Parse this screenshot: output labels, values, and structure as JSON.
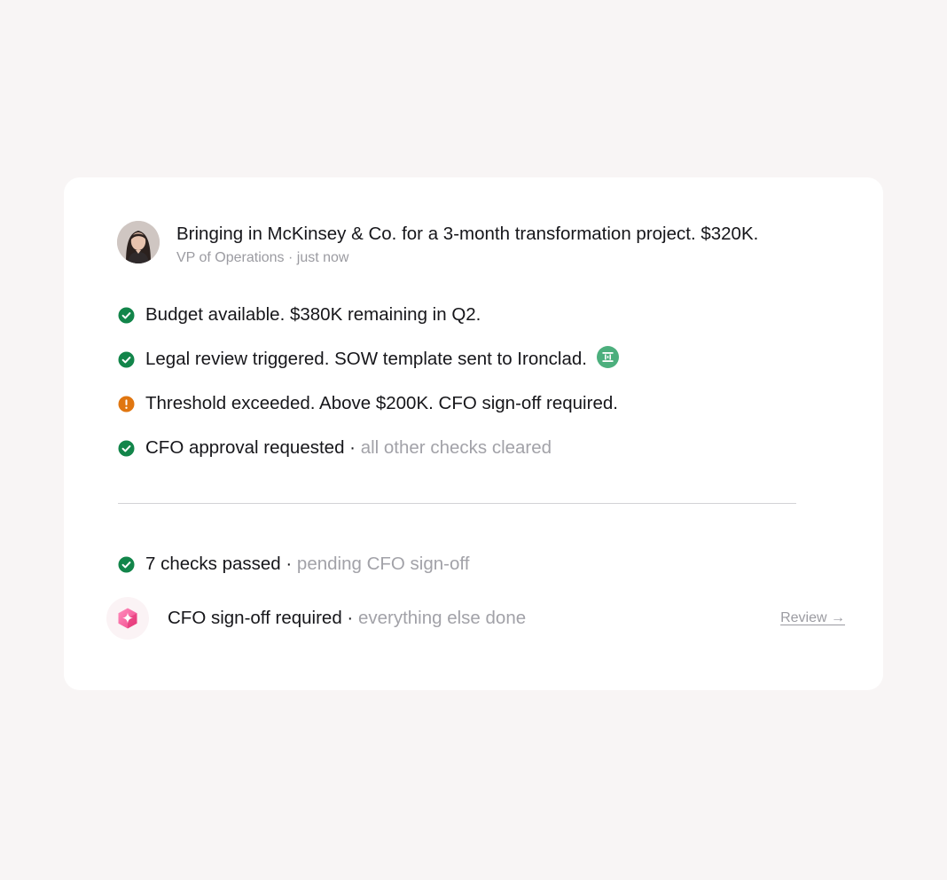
{
  "request": {
    "title": "Bringing in McKinsey & Co. for a 3-month transformation project. $320K.",
    "role": "VP of Operations",
    "meta_separator": " · ",
    "time": "just now"
  },
  "checks": [
    {
      "status": "passed",
      "icon": "check-circle-icon",
      "text": "Budget available. $380K remaining in Q2.",
      "detail": ""
    },
    {
      "status": "passed",
      "icon": "check-circle-icon",
      "text": "Legal review triggered. SOW template sent to Ironclad.",
      "detail": "",
      "integration_icon": "ironclad-icon"
    },
    {
      "status": "warning",
      "icon": "warning-circle-icon",
      "text": "Threshold exceeded. Above $200K. CFO sign-off required.",
      "detail": ""
    },
    {
      "status": "passed",
      "icon": "check-circle-icon",
      "text": "CFO approval requested",
      "detail": "all other checks cleared"
    }
  ],
  "summary": {
    "icon": "check-circle-icon",
    "text": "7 checks passed",
    "detail": "pending CFO sign-off"
  },
  "action": {
    "icon": "sparkle-cube-icon",
    "text": "CFO sign-off required",
    "detail": "everything else done",
    "link_label": "Review →"
  },
  "separator": " · ",
  "colors": {
    "success": "#12854a",
    "warning": "#e07610",
    "integration": "#4caf7d",
    "muted_text": "#a2a2a8",
    "background": "#f8f5f5",
    "card": "#ffffff",
    "action_accent": "#f0458a"
  }
}
